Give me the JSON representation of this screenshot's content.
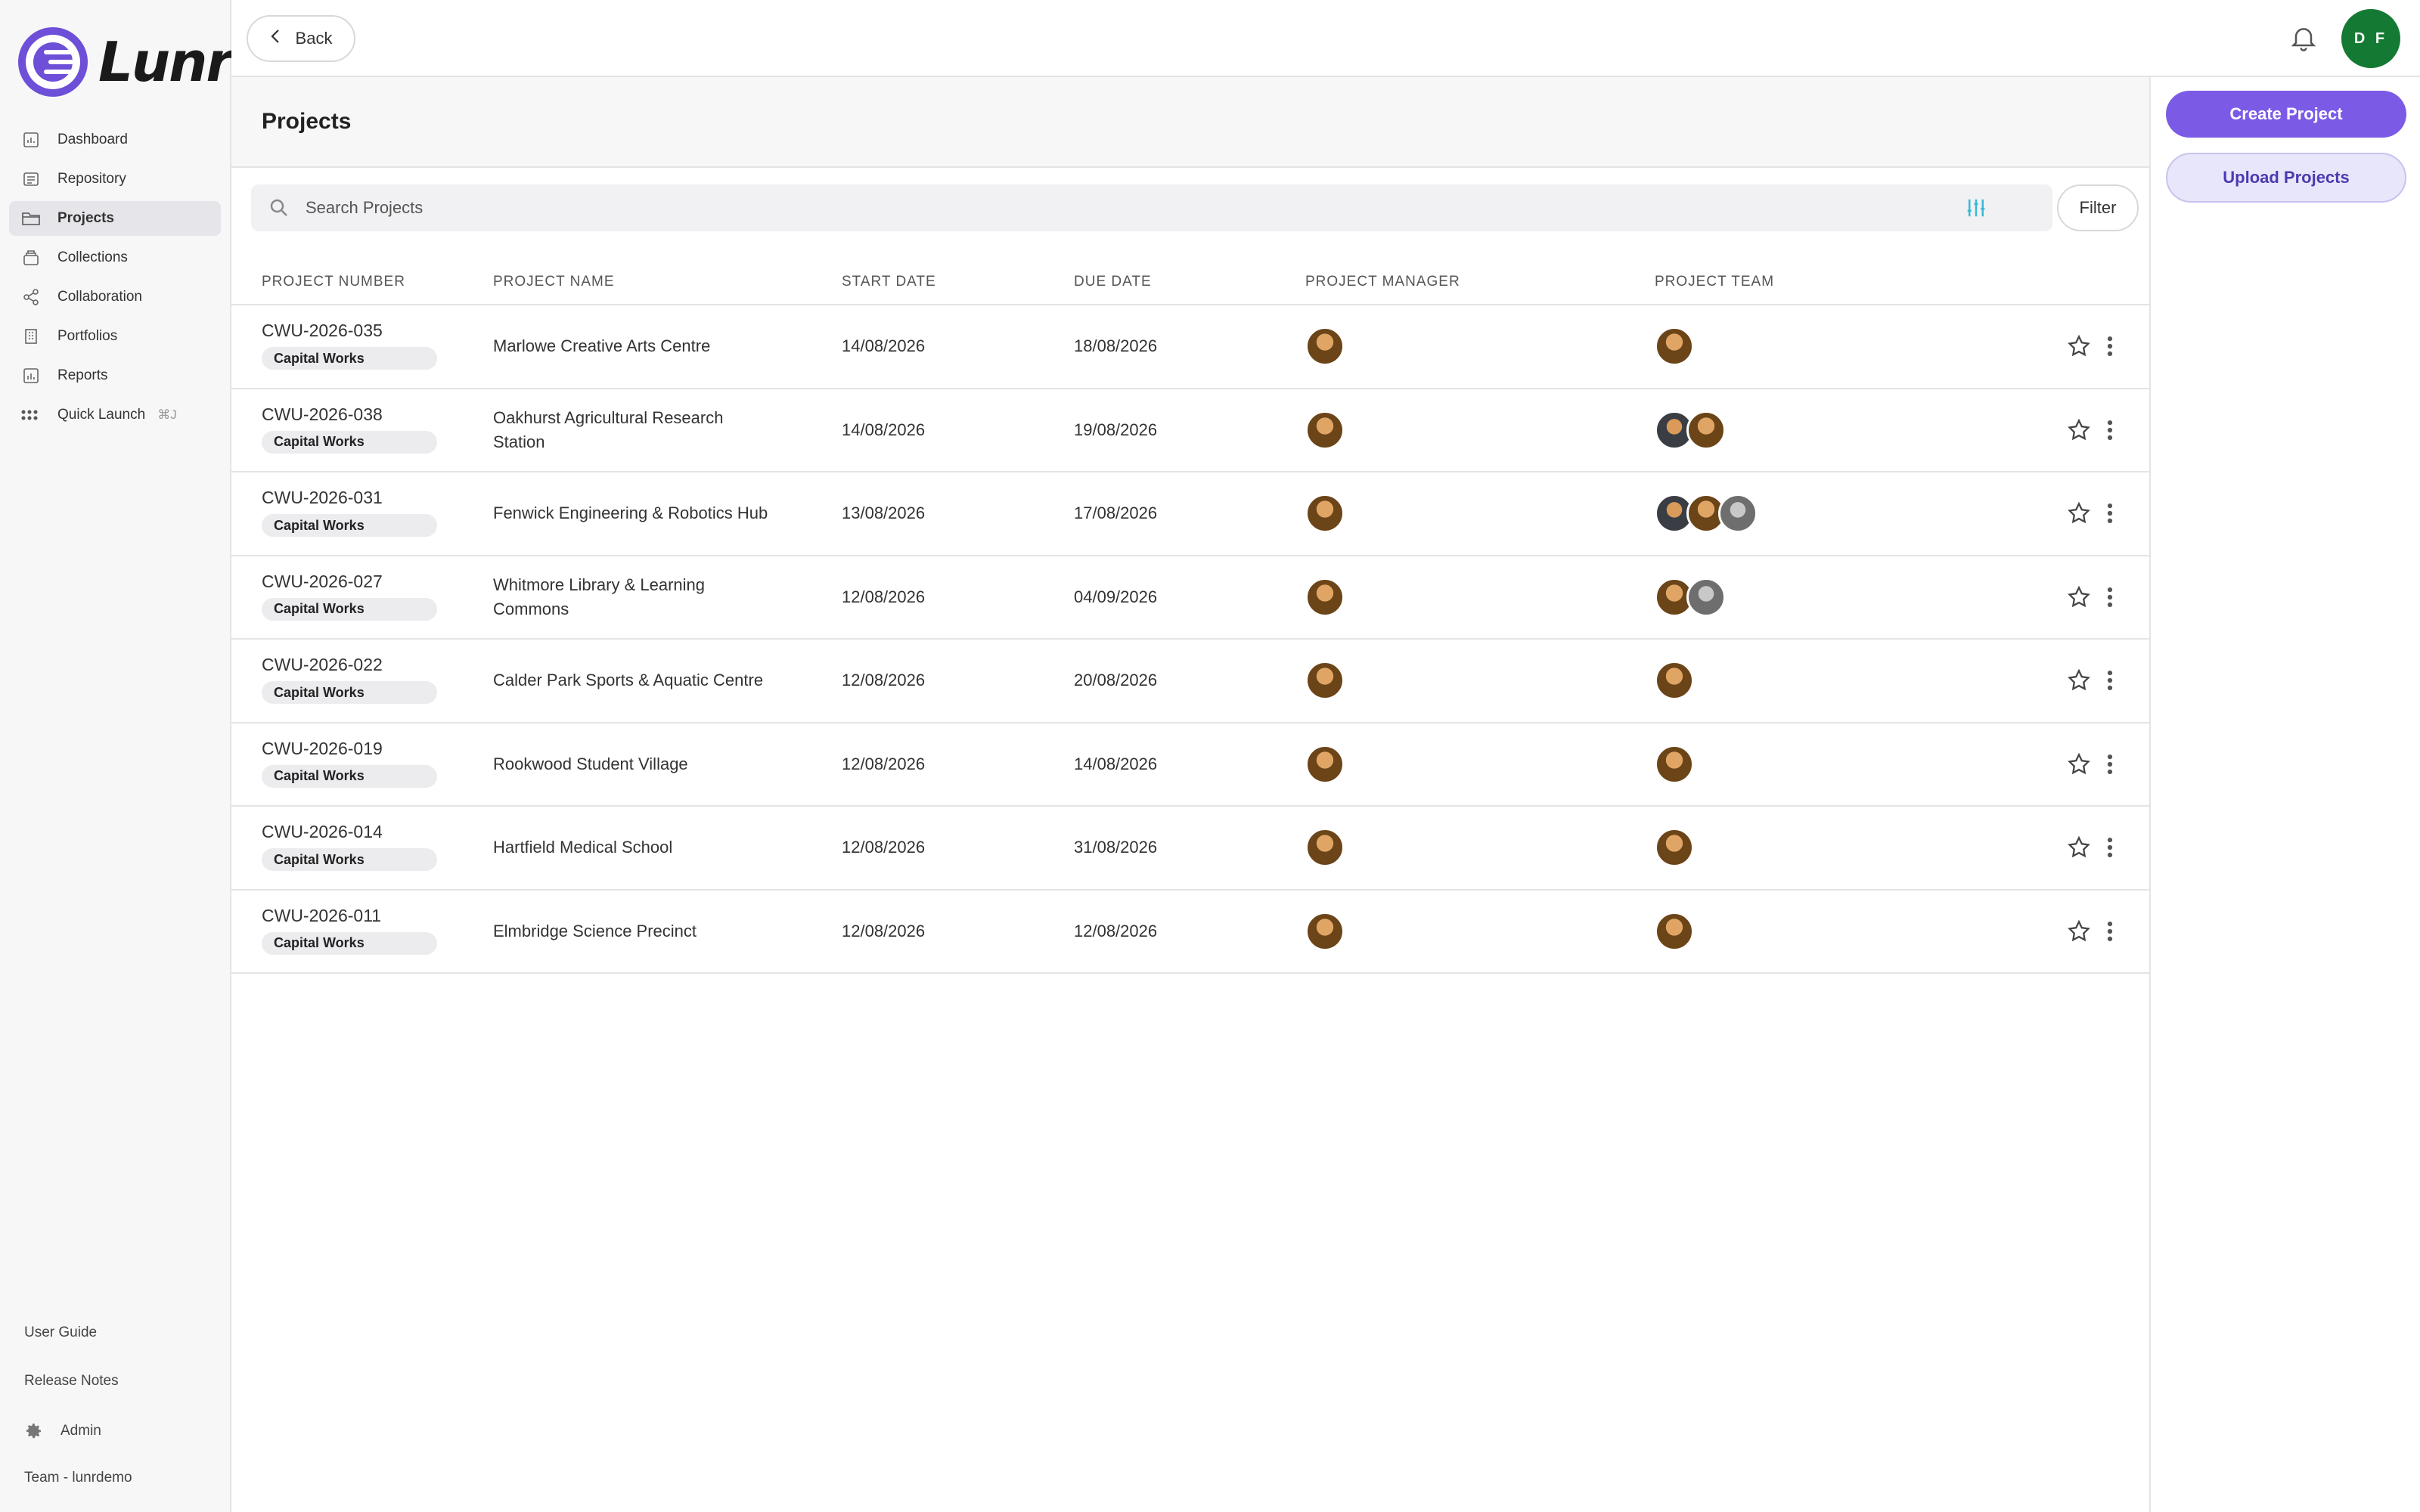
{
  "brand": {
    "name": "Lunr",
    "accent": "#6d4fd8"
  },
  "nav": {
    "items": [
      {
        "label": "Dashboard",
        "icon": "dashboard-icon"
      },
      {
        "label": "Repository",
        "icon": "repository-icon"
      },
      {
        "label": "Projects",
        "icon": "folder-icon",
        "active": true
      },
      {
        "label": "Collections",
        "icon": "collections-icon"
      },
      {
        "label": "Collaboration",
        "icon": "share-icon"
      },
      {
        "label": "Portfolios",
        "icon": "building-icon"
      },
      {
        "label": "Reports",
        "icon": "chart-icon"
      },
      {
        "label": "Quick Launch",
        "icon": "grid-dots-icon",
        "shortcut": "⌘J"
      }
    ]
  },
  "sidebar_bottom": {
    "user_guide": "User Guide",
    "release_notes": "Release Notes",
    "admin": "Admin",
    "team": "Team - lunrdemo"
  },
  "topbar": {
    "back_label": "Back",
    "user_initials": "D F",
    "user_color": "#147a33"
  },
  "page": {
    "title": "Projects"
  },
  "actions": {
    "create": "Create Project",
    "upload": "Upload Projects"
  },
  "search": {
    "placeholder": "Search Projects",
    "filter_label": "Filter"
  },
  "table": {
    "headers": [
      "PROJECT NUMBER",
      "PROJECT NAME",
      "START DATE",
      "DUE DATE",
      "PROJECT MANAGER",
      "PROJECT TEAM"
    ],
    "rows": [
      {
        "number": "CWU-2026-035",
        "tag": "Capital Works",
        "name": "Marlowe Creative Arts Centre",
        "start": "14/08/2026",
        "due": "18/08/2026",
        "team_size": 1
      },
      {
        "number": "CWU-2026-038",
        "tag": "Capital Works",
        "name": "Oakhurst Agricultural Research Station",
        "start": "14/08/2026",
        "due": "19/08/2026",
        "team_size": 2
      },
      {
        "number": "CWU-2026-031",
        "tag": "Capital Works",
        "name": "Fenwick Engineering & Robotics Hub",
        "start": "13/08/2026",
        "due": "17/08/2026",
        "team_size": 3
      },
      {
        "number": "CWU-2026-027",
        "tag": "Capital Works",
        "name": "Whitmore Library & Learning Commons",
        "start": "12/08/2026",
        "due": "04/09/2026",
        "team_size": 2
      },
      {
        "number": "CWU-2026-022",
        "tag": "Capital Works",
        "name": "Calder Park Sports & Aquatic Centre",
        "start": "12/08/2026",
        "due": "20/08/2026",
        "team_size": 1
      },
      {
        "number": "CWU-2026-019",
        "tag": "Capital Works",
        "name": "Rookwood Student Village",
        "start": "12/08/2026",
        "due": "14/08/2026",
        "team_size": 1
      },
      {
        "number": "CWU-2026-014",
        "tag": "Capital Works",
        "name": "Hartfield Medical School",
        "start": "12/08/2026",
        "due": "31/08/2026",
        "team_size": 1
      },
      {
        "number": "CWU-2026-011",
        "tag": "Capital Works",
        "name": "Elmbridge Science Precinct",
        "start": "12/08/2026",
        "due": "12/08/2026",
        "team_size": 1
      }
    ]
  }
}
